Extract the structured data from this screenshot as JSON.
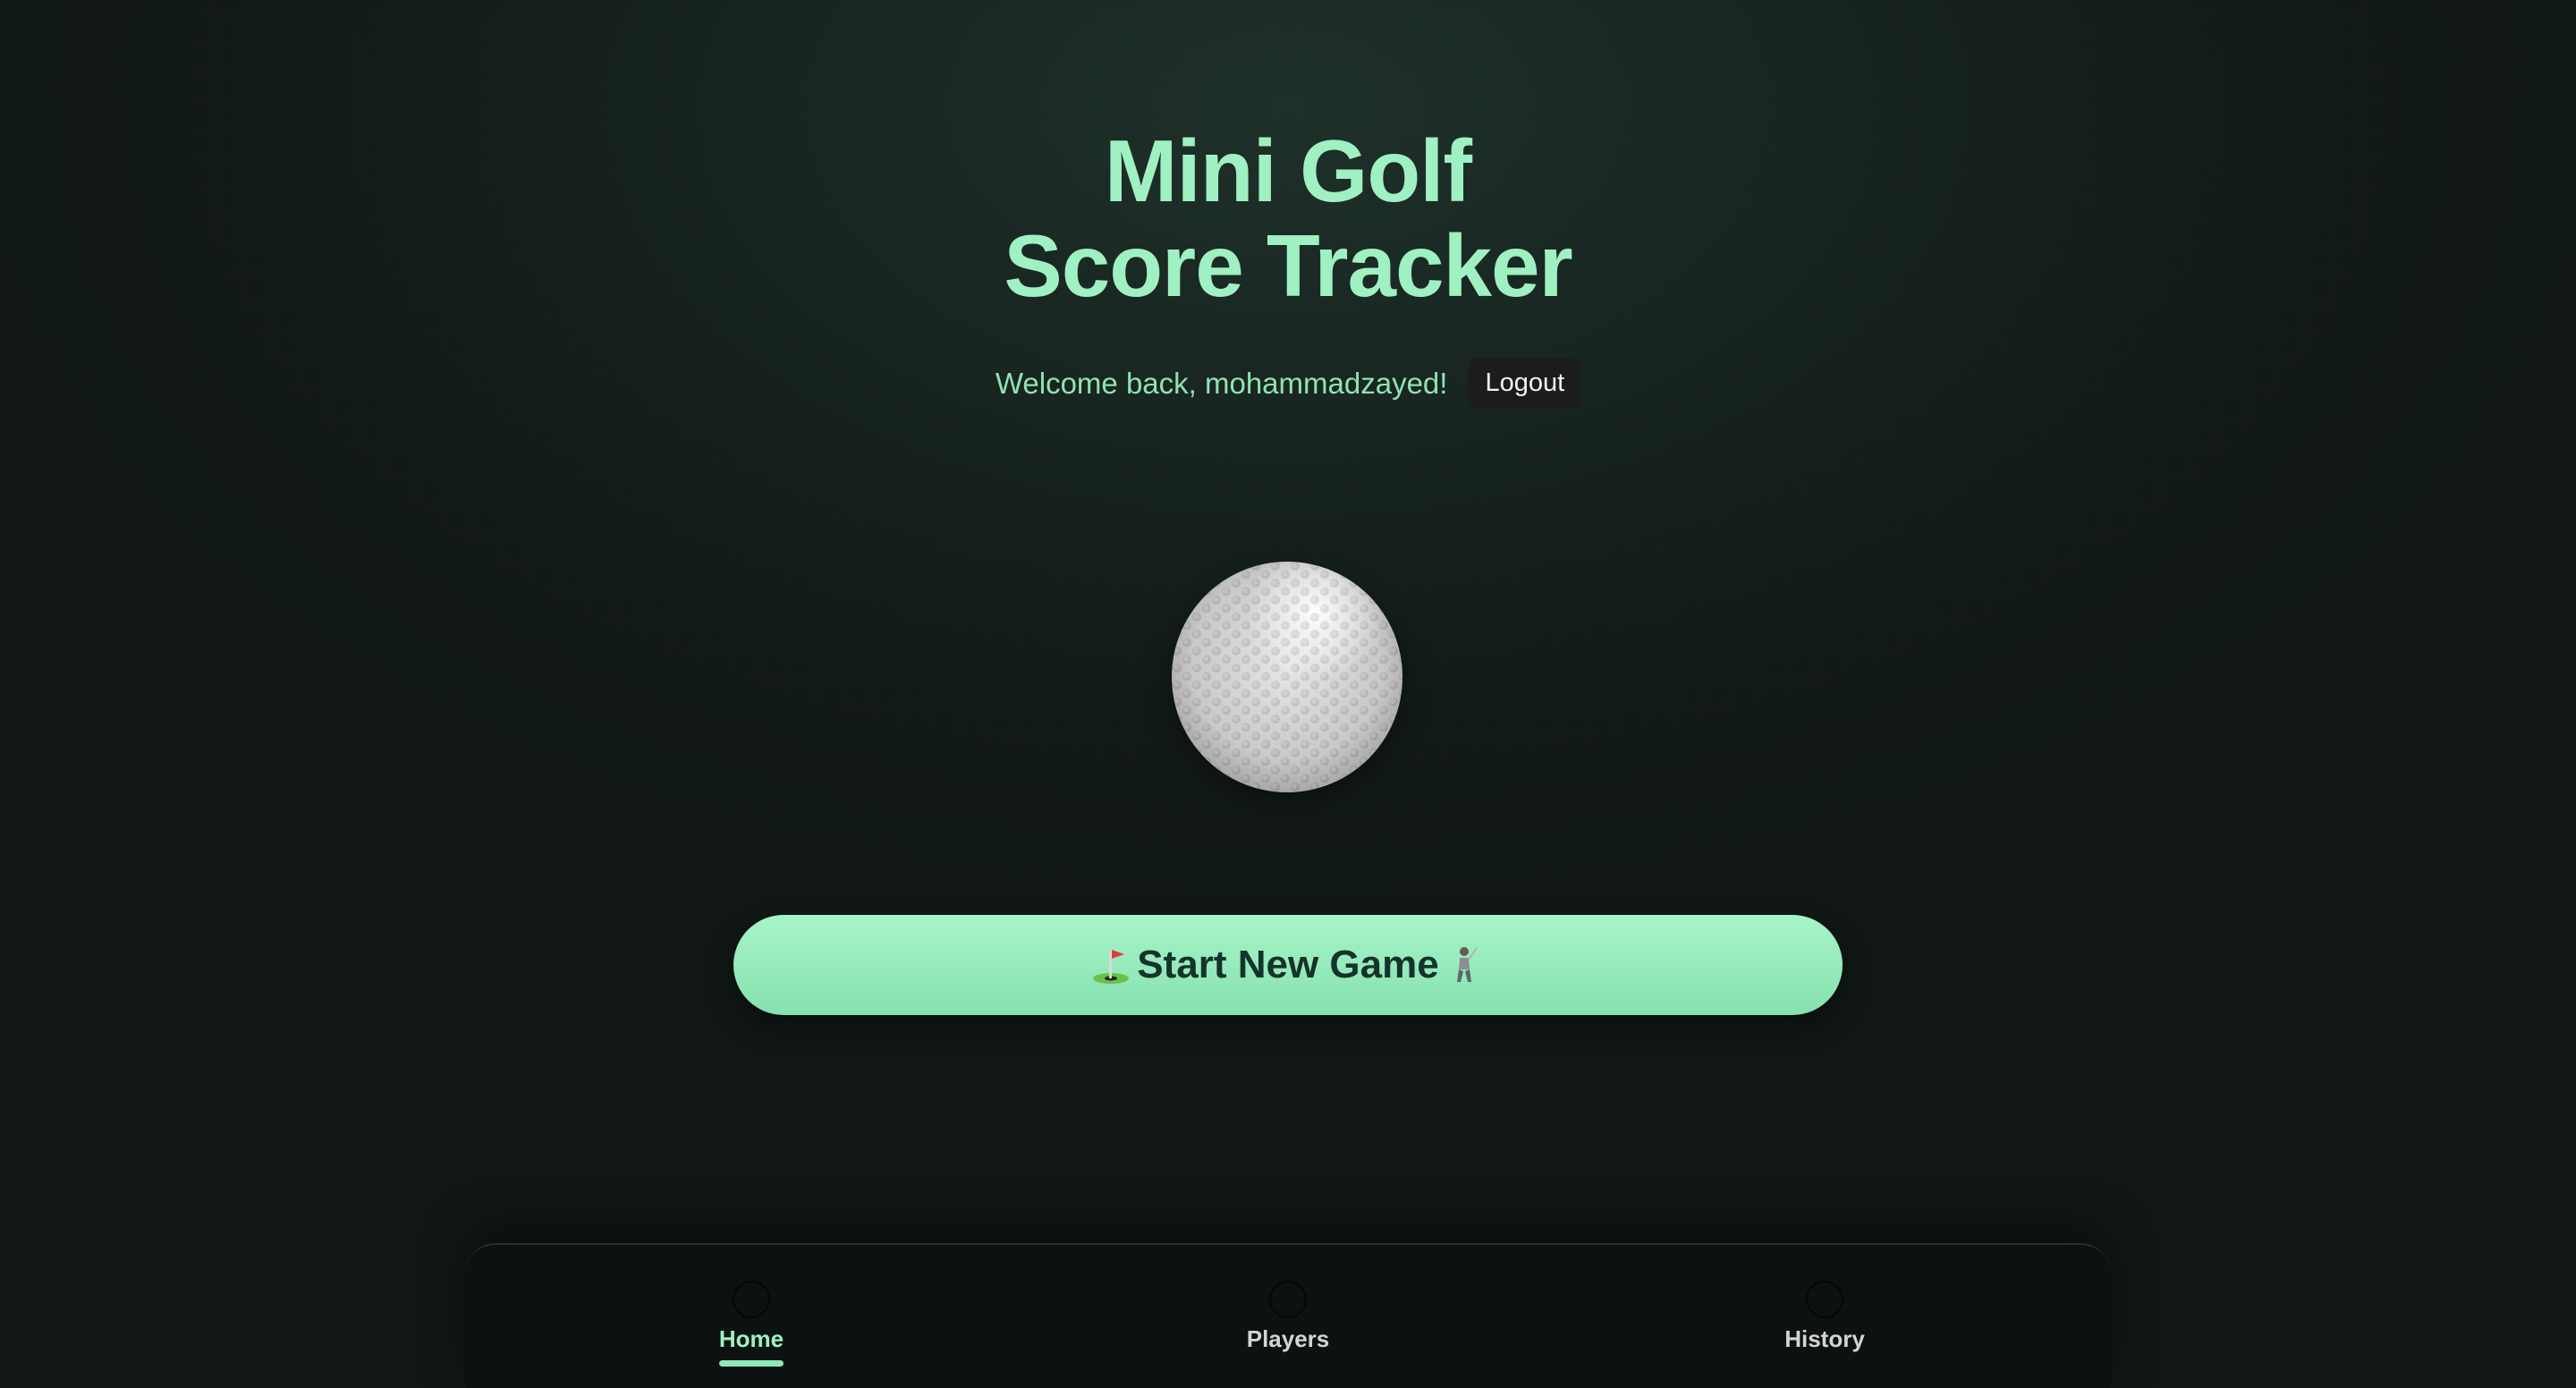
{
  "header": {
    "title_line1": "Mini Golf",
    "title_line2": "Score Tracker"
  },
  "user_bar": {
    "welcome_text": "Welcome back, mohammadzayed!",
    "logout_label": "Logout"
  },
  "hero": {
    "icon": "golf-ball-icon"
  },
  "cta": {
    "label": "Start New Game",
    "leading_icon": "flag-in-hole-icon",
    "trailing_icon": "golfer-icon"
  },
  "nav": {
    "active": "Home",
    "items": [
      {
        "label": "Home",
        "icon": "home-icon"
      },
      {
        "label": "Players",
        "icon": "players-icon"
      },
      {
        "label": "History",
        "icon": "history-icon"
      }
    ]
  },
  "colors": {
    "accent": "#9ff0c2",
    "button_gradient_top": "#a6f5c8",
    "button_gradient_bottom": "#86e0b0",
    "background": "#17231f",
    "nav_background": "#0c1211"
  }
}
